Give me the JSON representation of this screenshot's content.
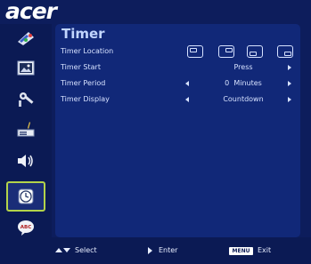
{
  "brand": {
    "logo_text": "acer"
  },
  "sidebar": {
    "items": [
      {
        "name": "color",
        "icon": "color-palette-icon"
      },
      {
        "name": "image",
        "icon": "image-icon"
      },
      {
        "name": "management",
        "icon": "settings-tools-icon"
      },
      {
        "name": "setting",
        "icon": "projector-setting-icon"
      },
      {
        "name": "audio",
        "icon": "speaker-icon"
      },
      {
        "name": "timer",
        "icon": "clock-icon",
        "active": true
      },
      {
        "name": "language",
        "icon": "abc-speech-bubble-icon"
      }
    ],
    "active_color": "#b3d34a"
  },
  "panel": {
    "title": "Timer",
    "rows": [
      {
        "label": "Timer Location",
        "value": ""
      },
      {
        "label": "Timer Start",
        "value": "Press"
      },
      {
        "label": "Timer Period",
        "value": "0  Minutes"
      },
      {
        "label": "Timer Display",
        "value": "Countdown"
      }
    ]
  },
  "footer": {
    "select_label": "Select",
    "enter_label": "Enter",
    "menu_badge": "MENU",
    "exit_label": "Exit"
  },
  "colors": {
    "background": "#0d1d5c",
    "panel": "#112878",
    "title": "#c2d6ff",
    "text": "#d7e2ff"
  }
}
